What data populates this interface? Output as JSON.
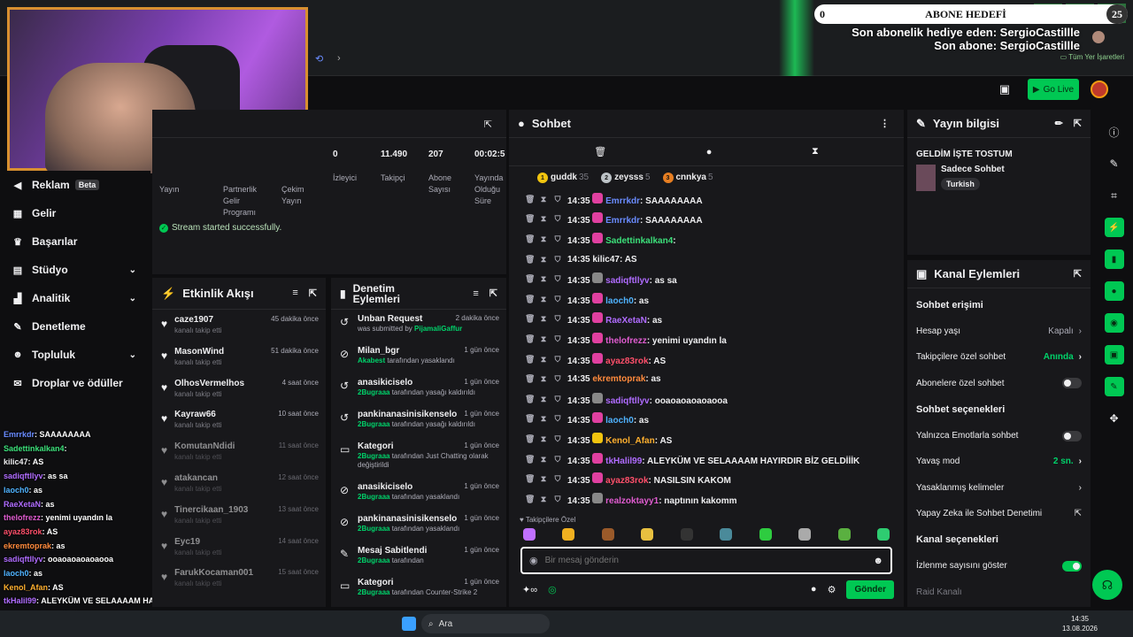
{
  "overlay": {
    "goal_current": "0",
    "goal_label": "ABONE HEDEFİ",
    "goal_total": "25",
    "last_gift": "Son abonelik hediye eden: SergioCastillle",
    "last_sub": "Son abone: SergioCastillle",
    "bookmarks": "Tüm Yer İşaretleri"
  },
  "topnav": {
    "go_live": "Go Live"
  },
  "sidebar": {
    "items": [
      {
        "label": "Reklam",
        "badge": "Beta",
        "icon": "megaphone-icon"
      },
      {
        "label": "Gelir",
        "icon": "bank-icon"
      },
      {
        "label": "Başarılar",
        "icon": "trophy-icon"
      },
      {
        "label": "Stüdyo",
        "icon": "film-icon",
        "chevron": true
      },
      {
        "label": "Analitik",
        "icon": "chart-icon",
        "chevron": true
      },
      {
        "label": "Denetleme",
        "icon": "wrench-icon"
      },
      {
        "label": "Topluluk",
        "icon": "people-icon",
        "chevron": true
      },
      {
        "label": "Droplar ve ödüller",
        "icon": "gift-icon"
      }
    ]
  },
  "stats": {
    "cells": [
      {
        "value": "",
        "label": "Yayın"
      },
      {
        "value": "",
        "label": "Partnerlik Gelir Programı"
      },
      {
        "value": "",
        "label": "Çekim Yayın"
      },
      {
        "value": "0",
        "label": "İzleyici"
      },
      {
        "value": "11.490",
        "label": "Takipçi"
      },
      {
        "value": "207",
        "label": "Abone Sayısı"
      },
      {
        "value": "00:02:5",
        "label": "Yayında Olduğu Süre"
      }
    ],
    "status": "Stream started successfully."
  },
  "activity": {
    "title": "Etkinlik Akışı",
    "items": [
      {
        "name": "caze1907",
        "sub": "kanalı takip etti",
        "time": "45 dakika önce"
      },
      {
        "name": "MasonWind",
        "sub": "kanalı takip etti",
        "time": "51 dakika önce"
      },
      {
        "name": "OlhosVermelhos",
        "sub": "kanalı takip etti",
        "time": "4 saat önce"
      },
      {
        "name": "Kayraw66",
        "sub": "kanalı takip etti",
        "time": "10 saat önce"
      },
      {
        "name": "KomutanNdidi",
        "sub": "kanalı takip etti",
        "time": "11 saat önce"
      },
      {
        "name": "atakancan",
        "sub": "kanalı takip etti",
        "time": "12 saat önce"
      },
      {
        "name": "Tinercikaan_1903",
        "sub": "kanalı takip etti",
        "time": "13 saat önce"
      },
      {
        "name": "Eyc19",
        "sub": "kanalı takip etti",
        "time": "14 saat önce"
      },
      {
        "name": "FarukKocaman001",
        "sub": "kanalı takip etti",
        "time": "15 saat önce"
      }
    ]
  },
  "moderation": {
    "title": "Denetim Eylemleri",
    "items": [
      {
        "name": "Unban Request",
        "pre": "was submitted by ",
        "actor": "PijamaliGaffur",
        "post": "",
        "time": "2 dakika önce",
        "icon": "undo-icon"
      },
      {
        "name": "Milan_bgr",
        "pre": "",
        "actor": "Akabest",
        "post": " tarafından yasaklandı",
        "time": "1 gün önce",
        "icon": "ban-icon"
      },
      {
        "name": "anasikiciselo",
        "pre": "",
        "actor": "2Bugraaa",
        "post": " tarafından yasağı kaldırıldı",
        "time": "1 gün önce",
        "icon": "undo-icon"
      },
      {
        "name": "pankinanasinisikenselo",
        "pre": "",
        "actor": "2Bugraaa",
        "post": " tarafından yasağı kaldırıldı",
        "time": "1 gün önce",
        "icon": "undo-icon"
      },
      {
        "name": "Kategori",
        "pre": "",
        "actor": "2Bugraaa",
        "post": " tarafından Just Chatting olarak değiştirildi",
        "time": "1 gün önce",
        "icon": "category-icon"
      },
      {
        "name": "anasikiciselo",
        "pre": "",
        "actor": "2Bugraaa",
        "post": " tarafından yasaklandı",
        "time": "1 gün önce",
        "icon": "ban-icon"
      },
      {
        "name": "pankinanasinisikenselo",
        "pre": "",
        "actor": "2Bugraaa",
        "post": " tarafından yasaklandı",
        "time": "1 gün önce",
        "icon": "ban-icon"
      },
      {
        "name": "Mesaj Sabitlendi",
        "pre": "",
        "actor": "2Bugraaa",
        "post": " tarafından",
        "time": "1 gün önce",
        "icon": "pin-icon"
      },
      {
        "name": "Kategori",
        "pre": "",
        "actor": "2Bugraaa",
        "post": " tarafından Counter-Strike 2",
        "time": "1 gün önce",
        "icon": "category-icon"
      }
    ]
  },
  "chat": {
    "title": "Sohbet",
    "leaders": [
      {
        "rank": "1",
        "name": "guddk",
        "count": "35",
        "color": "#f1c40f"
      },
      {
        "rank": "2",
        "name": "zeysss",
        "count": "5",
        "color": "#bdc3c7"
      },
      {
        "rank": "3",
        "name": "cnnkya",
        "count": "5",
        "color": "#e67e22"
      }
    ],
    "messages": [
      {
        "time": "14:35",
        "user": "Emrrkdr",
        "text": ": SAAAAAAAA",
        "color": "#6a8cff",
        "badge": "#e040a0"
      },
      {
        "time": "14:35",
        "user": "Emrrkdr",
        "text": ": SAAAAAAAA",
        "color": "#6a8cff",
        "badge": "#e040a0"
      },
      {
        "time": "14:35",
        "user": "Sadettinkalkan4",
        "text": ":",
        "color": "#3ce07a",
        "badge": "#e040a0"
      },
      {
        "time": "14:35",
        "user": "kilic47",
        "text": ": AS",
        "color": "#efeff1",
        "badge": ""
      },
      {
        "time": "14:35",
        "user": "sadiqftllyv",
        "text": ": as sa",
        "color": "#b06cff",
        "badge": "#888"
      },
      {
        "time": "14:35",
        "user": "laoch0",
        "text": ": as",
        "color": "#4fb3ff",
        "badge": "#e040a0"
      },
      {
        "time": "14:35",
        "user": "RaeXetaN",
        "text": ": as",
        "color": "#b06cff",
        "badge": "#e040a0"
      },
      {
        "time": "14:35",
        "user": "thelofrezz",
        "text": ": yenimi uyandın la",
        "color": "#e05cd0",
        "badge": "#e040a0"
      },
      {
        "time": "14:35",
        "user": "ayaz83rok",
        "text": ": AS",
        "color": "#ff4f6a",
        "badge": "#e040a0"
      },
      {
        "time": "14:35",
        "user": "ekremtoprak",
        "text": ": as",
        "color": "#ff8a3c",
        "badge": ""
      },
      {
        "time": "14:35",
        "user": "sadiqftllyv",
        "text": ": ooaoaoaoaoaooa",
        "color": "#b06cff",
        "badge": "#888"
      },
      {
        "time": "14:35",
        "user": "laoch0",
        "text": ": as",
        "color": "#4fb3ff",
        "badge": "#e040a0"
      },
      {
        "time": "14:35",
        "user": "Kenol_Afan",
        "text": ": AS",
        "color": "#ffb02e",
        "badge": "#f1c40f"
      },
      {
        "time": "14:35",
        "user": "tkHalil99",
        "text": ": ALEYKÜM VE SELAAAAM HAYIRDIR BİZ GELDİİİK",
        "color": "#b06cff",
        "badge": "#e040a0"
      },
      {
        "time": "14:35",
        "user": "ayaz83rok",
        "text": ": NASILSIN KAKOM",
        "color": "#ff4f6a",
        "badge": "#e040a0"
      },
      {
        "time": "14:35",
        "user": "realzoktayy1",
        "text": ": naptının kakomm",
        "color": "#e05cd0",
        "badge": "#888"
      }
    ],
    "followers_only": "Takipçilere Özel",
    "placeholder": "Bir mesaj gönderin",
    "send": "Gönder"
  },
  "overlay_chat": [
    {
      "user": "Emrrkdr",
      "text": ": SAAAAAAAA",
      "color": "#6a8cff"
    },
    {
      "user": "Sadettinkalkan4",
      "text": ":",
      "color": "#3ce07a"
    },
    {
      "user": "kilic47",
      "text": ": AS",
      "color": "#efeff1"
    },
    {
      "user": "sadiqftllyv",
      "text": ": as sa",
      "color": "#b06cff"
    },
    {
      "user": "laoch0",
      "text": ": as",
      "color": "#4fb3ff"
    },
    {
      "user": "RaeXetaN",
      "text": ": as",
      "color": "#b06cff"
    },
    {
      "user": "thelofrezz",
      "text": ": yenimi uyandın la",
      "color": "#e05cd0"
    },
    {
      "user": "ayaz83rok",
      "text": ": AS",
      "color": "#ff4f6a"
    },
    {
      "user": "ekremtoprak",
      "text": ": as",
      "color": "#ff8a3c"
    },
    {
      "user": "sadiqftllyv",
      "text": ": ooaoaoaoaoaooa",
      "color": "#b06cff"
    },
    {
      "user": "laoch0",
      "text": ": as",
      "color": "#4fb3ff"
    },
    {
      "user": "Kenol_Afan",
      "text": ": AS",
      "color": "#ffb02e"
    },
    {
      "user": "tkHalil99",
      "text": ": ALEYKÜM VE SELAAAAM HAYIRDIR BİZ GELDİİİK",
      "color": "#b06cff"
    },
    {
      "user": "ayaz83rok",
      "text": ": NASILSIN KAKOM",
      "color": "#ff4f6a"
    },
    {
      "user": "realzoktayy1",
      "text": ": naptının kakomm",
      "color": "#e05cd0"
    }
  ],
  "stream_info": {
    "title": "Yayın bilgisi",
    "stream_title": "GELDİM İŞTE TOSTUM",
    "category": "Sadece Sohbet",
    "tag": "Turkish"
  },
  "channel": {
    "title": "Kanal Eylemleri",
    "sections": {
      "chat_access": "Sohbet erişimi",
      "chat_options": "Sohbet seçenekleri",
      "channel_options": "Kanal seçenekleri"
    },
    "access_rows": [
      {
        "label": "Hesap yaşı",
        "value": "Kapalı",
        "green": false
      },
      {
        "label": "Takipçilere özel sohbet",
        "value": "Anında",
        "green": true
      }
    ],
    "sub_only": "Abonelere özel sohbet",
    "emote_only": "Yalnızca Emotlarla sohbet",
    "slow_mode": {
      "label": "Yavaş mod",
      "value": "2 sn."
    },
    "banned_words": "Yasaklanmış kelimeler",
    "ai_mod": "Yapay Zeka ile Sohbet Denetimi",
    "show_views": "İzlenme sayısını göster",
    "raid": "Raid Kanalı"
  },
  "taskbar": {
    "search": "Ara",
    "time": "14:35",
    "date": "13.08.2026"
  }
}
